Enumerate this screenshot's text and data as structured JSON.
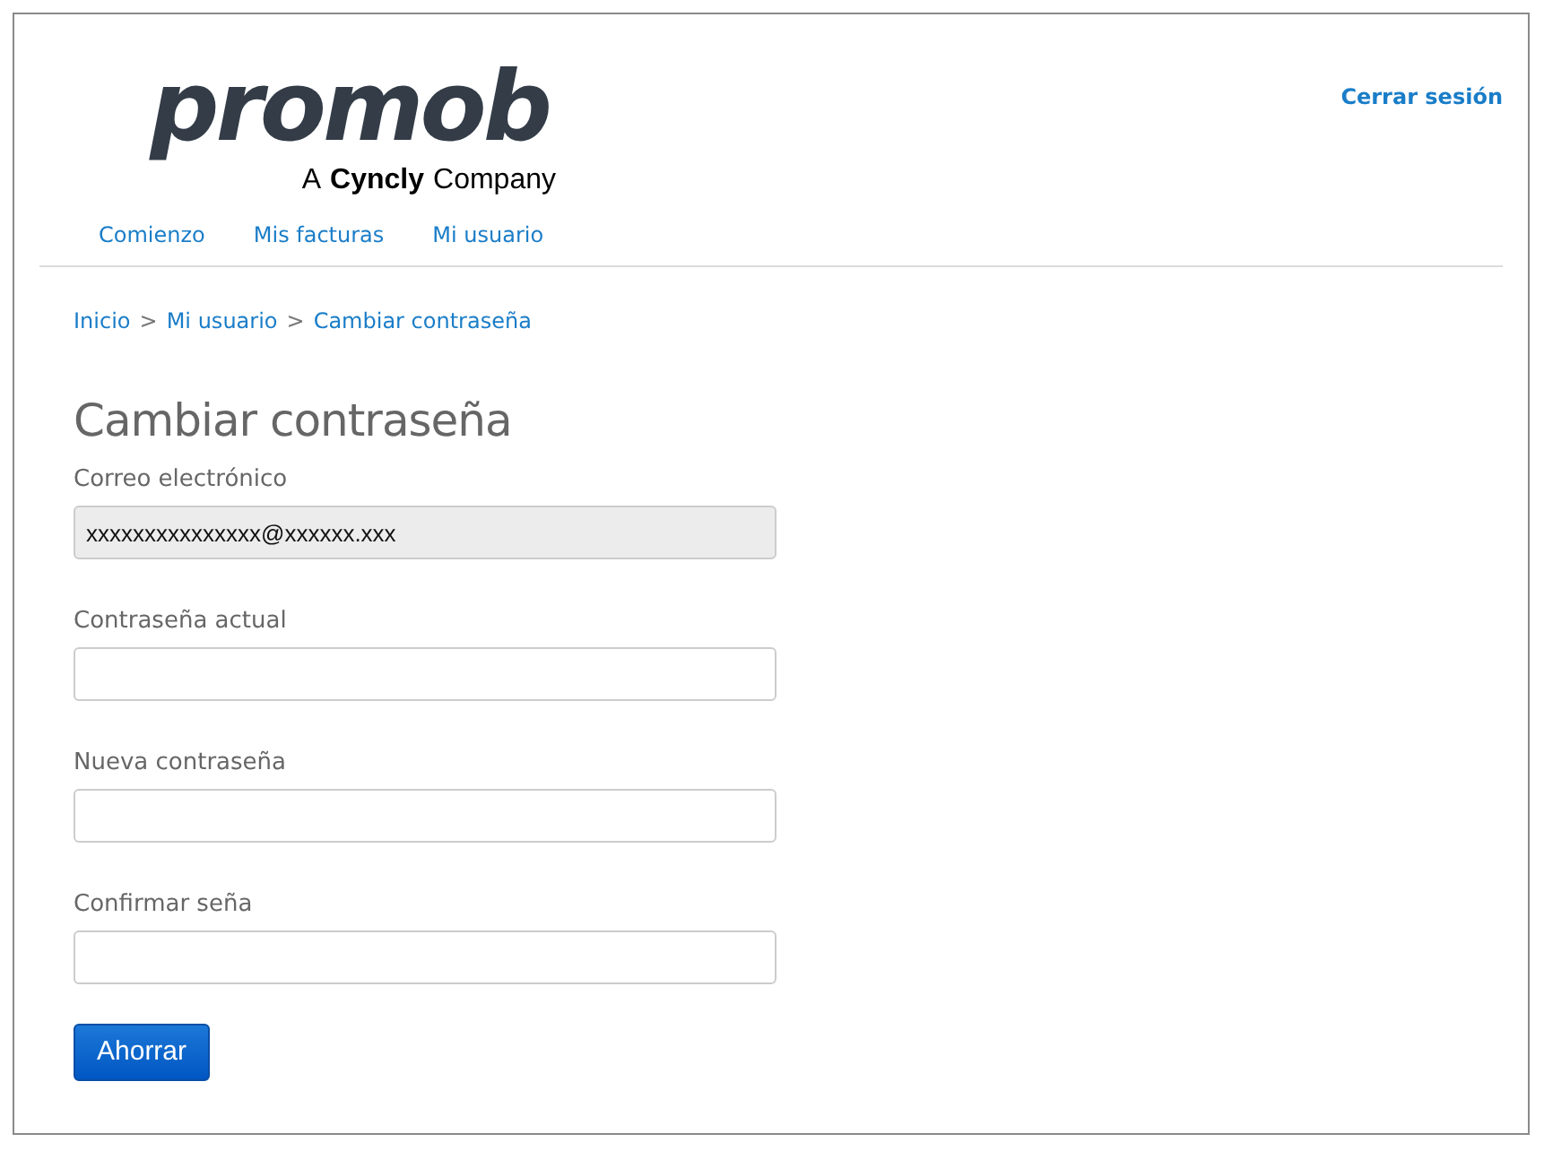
{
  "logo": {
    "wordmark": "promob",
    "tagline_prefix": "A",
    "tagline_brand": "Cyncly",
    "tagline_suffix": "Company"
  },
  "logout": "Cerrar sesión",
  "nav": [
    {
      "label": "Comienzo"
    },
    {
      "label": "Mis facturas"
    },
    {
      "label": "Mi usuario"
    }
  ],
  "breadcrumb": [
    {
      "label": "Inicio"
    },
    {
      "label": "Mi usuario"
    },
    {
      "label": "Cambiar contraseña"
    }
  ],
  "breadcrumb_separator": ">",
  "heading": "Cambiar contraseña",
  "fields": [
    {
      "label": "Correo electrónico",
      "value": "xxxxxxxxxxxxxxx@xxxxxx.xxx",
      "disabled": true
    },
    {
      "label": "Contraseña actual",
      "disabled": false
    },
    {
      "label": "Nueva contraseña",
      "disabled": false
    },
    {
      "label": "Confirmar seña",
      "disabled": false
    }
  ],
  "submit": "Ahorrar"
}
